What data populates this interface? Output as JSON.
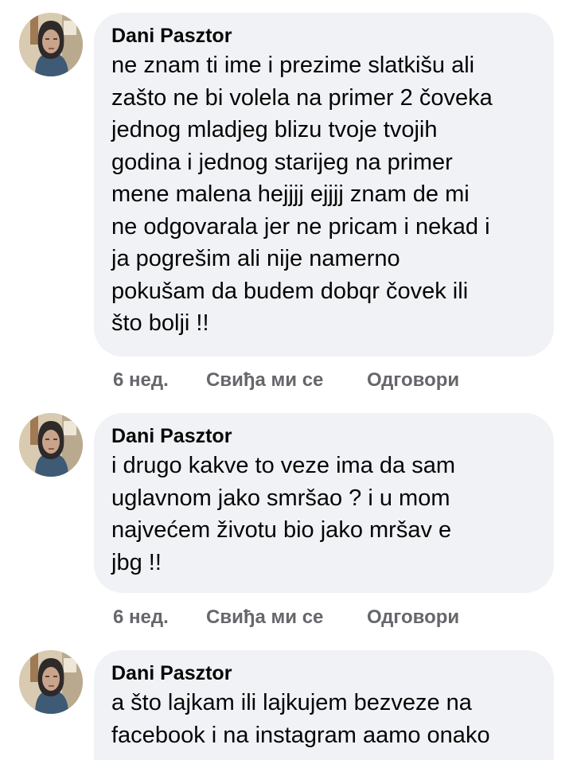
{
  "comments": [
    {
      "author": "Dani Pasztor",
      "lines": [
        "ne znam ti ime i prezime slatkišu ali",
        "zašto ne bi volela na primer 2 čoveka",
        "jednog mladjeg blizu tvoje tvojih",
        "godina i jednog starijeg na primer",
        "mene malena hejjjj ejjjj znam de mi",
        "ne odgovarala jer ne pricam i nekad i",
        "ja pogrešim ali nije namerno",
        "pokušam da budem dobqr čovek ili",
        "što bolji !!"
      ],
      "time": "6 нед.",
      "like_label": "Свиђа ми се",
      "reply_label": "Одговори"
    },
    {
      "author": "Dani Pasztor",
      "lines": [
        "i drugo kakve to veze ima da sam",
        "uglavnom jako smršao ? i u mom",
        "najvećem životu bio jako mršav e",
        "jbg !!"
      ],
      "time": "6 нед.",
      "like_label": "Свиђа ми се",
      "reply_label": "Одговори"
    },
    {
      "author": "Dani Pasztor",
      "lines": [
        "a što lajkam ili lajkujem bezveze na",
        "facebook i na instagram aamo onako"
      ]
    }
  ],
  "colors": {
    "bubble_bg": "#f0f2f5",
    "text": "#050505",
    "meta": "#65676b"
  },
  "icons": {
    "avatar": "profile-photo-avatar"
  }
}
